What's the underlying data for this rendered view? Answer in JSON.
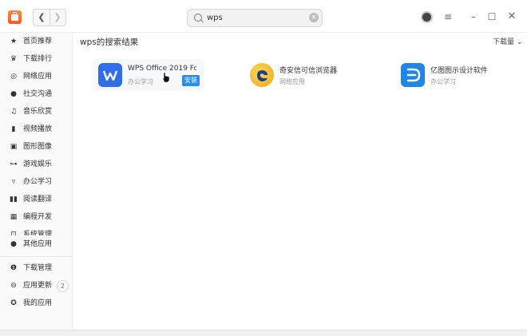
{
  "search": {
    "value": "wps"
  },
  "sidebar": {
    "items": [
      {
        "label": "首页推荐",
        "icon": "star-icon"
      },
      {
        "label": "下载排行",
        "icon": "crown-icon"
      },
      {
        "label": "网络应用",
        "icon": "globe-icon"
      },
      {
        "label": "社交沟通",
        "icon": "chat-icon"
      },
      {
        "label": "音乐欣赏",
        "icon": "music-icon"
      },
      {
        "label": "视频播放",
        "icon": "video-icon"
      },
      {
        "label": "图形图像",
        "icon": "image-icon"
      },
      {
        "label": "游戏娱乐",
        "icon": "gamepad-icon"
      },
      {
        "label": "办公学习",
        "icon": "briefcase-icon"
      },
      {
        "label": "阅读翻译",
        "icon": "book-icon"
      },
      {
        "label": "编程开发",
        "icon": "code-icon"
      },
      {
        "label": "系统管理",
        "icon": "system-icon"
      },
      {
        "label": "其他应用",
        "icon": "more-icon"
      }
    ],
    "bottom": [
      {
        "label": "下载管理",
        "icon": "download-icon"
      },
      {
        "label": "应用更新",
        "icon": "update-icon",
        "badge": "2"
      },
      {
        "label": "我的应用",
        "icon": "my-apps-icon"
      }
    ]
  },
  "main": {
    "results_title": "wps的搜索结果",
    "sort_label": "下载量 ⌄",
    "results": [
      {
        "name": "WPS Office 2019 Fo…",
        "category": "办公学习",
        "action": "安装",
        "icon": "wps-icon",
        "color": "#2f6ee8"
      },
      {
        "name": "奇安信可信浏览器",
        "category": "网络应用",
        "icon": "qianxin-browser-icon",
        "color": "#f5b82e"
      },
      {
        "name": "亿图图示设计软件",
        "category": "办公学习",
        "icon": "edraw-icon",
        "color": "#1f86e6"
      }
    ]
  },
  "colors": {
    "accent": "#2a8df0"
  }
}
